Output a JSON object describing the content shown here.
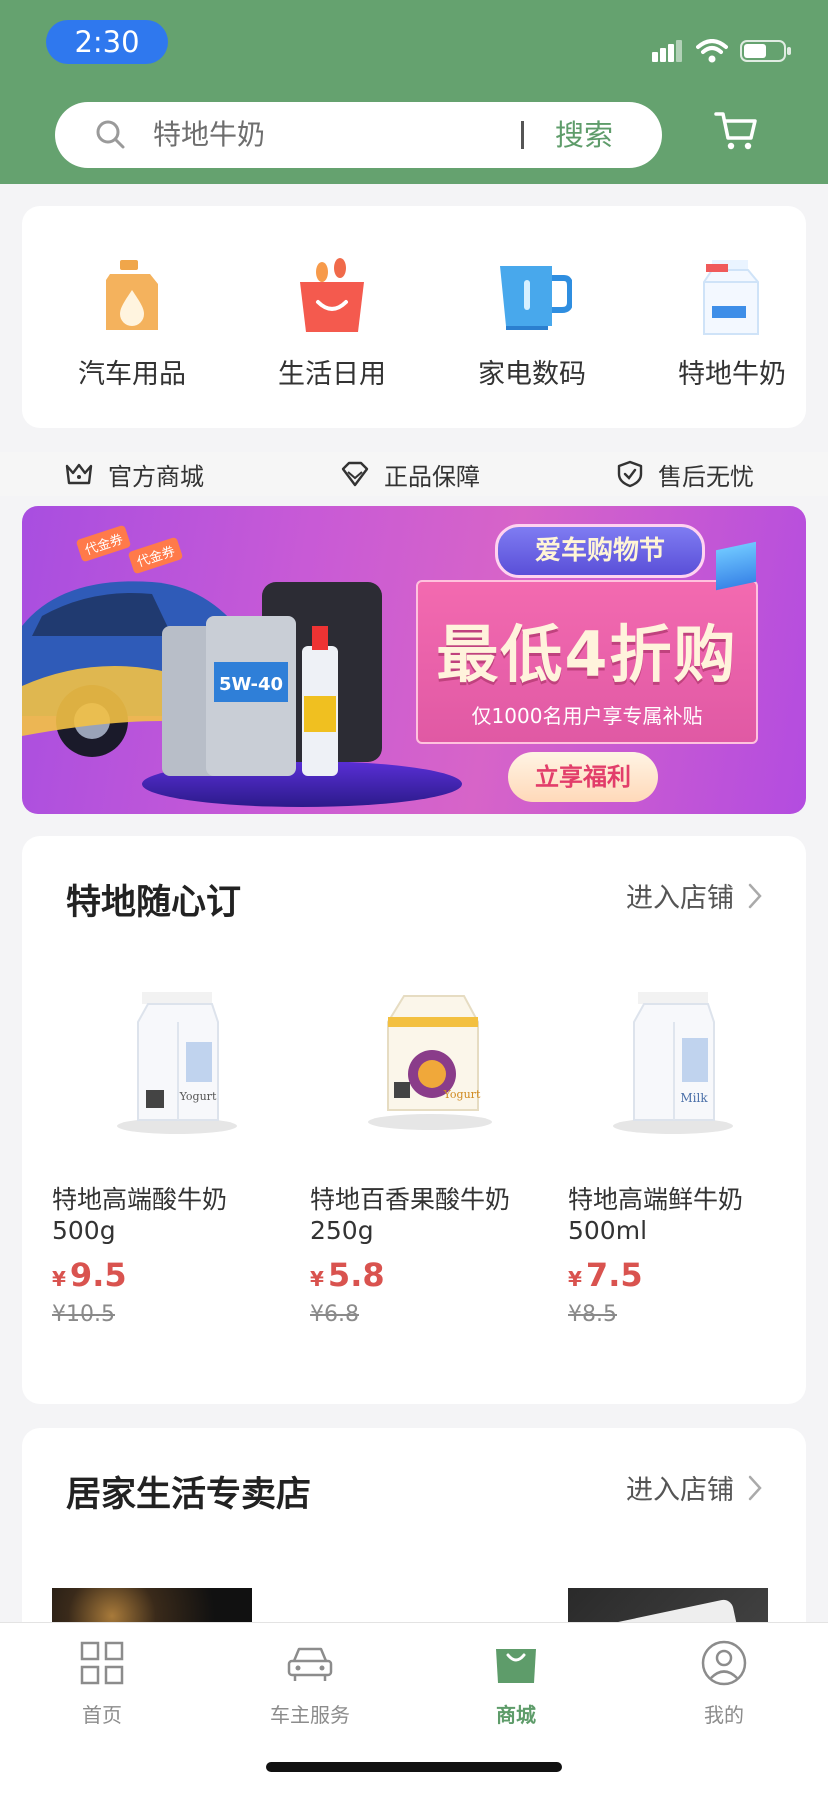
{
  "status_bar": {
    "time": "2:30"
  },
  "search": {
    "value": "特地牛奶",
    "button": "搜索"
  },
  "categories": [
    {
      "label": "汽车用品",
      "icon": "oil-can-icon"
    },
    {
      "label": "生活日用",
      "icon": "shopping-bag-icon"
    },
    {
      "label": "家电数码",
      "icon": "kettle-icon"
    },
    {
      "label": "特地牛奶",
      "icon": "milk-carton-icon"
    }
  ],
  "guarantees": [
    {
      "label": "官方商城",
      "icon": "crown-icon"
    },
    {
      "label": "正品保障",
      "icon": "diamond-icon"
    },
    {
      "label": "售后无忧",
      "icon": "shield-check-icon"
    }
  ],
  "banner": {
    "tag": "爱车购物节",
    "headline": "最低4折购",
    "subline": "仅1000名用户享专属补贴",
    "cta": "立享福利",
    "coupon_1": "代金券",
    "coupon_2": "代金券",
    "product_label": "5W-40"
  },
  "store1": {
    "title": "特地随心订",
    "link": "进入店铺",
    "products": [
      {
        "name": "特地高端酸牛奶500g",
        "currency": "¥",
        "price": "9.5",
        "original": "¥10.5",
        "carton": "Yogurt"
      },
      {
        "name": "特地百香果酸牛奶250g",
        "currency": "¥",
        "price": "5.8",
        "original": "¥6.8",
        "carton": "Yogurt"
      },
      {
        "name": "特地高端鲜牛奶500ml",
        "currency": "¥",
        "price": "7.5",
        "original": "¥8.5",
        "carton": "Milk"
      }
    ]
  },
  "store2": {
    "title": "居家生活专卖店",
    "link": "进入店铺"
  },
  "tabs": [
    {
      "label": "首页",
      "icon": "grid-icon",
      "active": false
    },
    {
      "label": "车主服务",
      "icon": "car-icon",
      "active": false
    },
    {
      "label": "商城",
      "icon": "mall-bag-icon",
      "active": true
    },
    {
      "label": "我的",
      "icon": "user-icon",
      "active": false
    }
  ],
  "colors": {
    "brand_green": "#65a26f",
    "price_red": "#d9534f",
    "search_text": "#5e9c6a"
  }
}
